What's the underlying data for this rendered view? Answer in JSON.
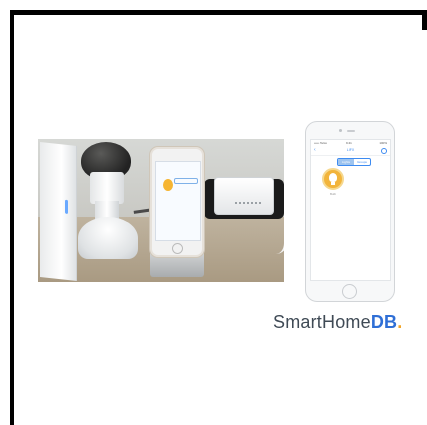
{
  "brand": {
    "prefix": "SmartHome",
    "suffix": "DB",
    "dot": "."
  },
  "phone_app": {
    "status": {
      "carrier": "••••• Telco",
      "time": "9:41",
      "battery": "100%"
    },
    "nav": {
      "back_icon": "chevron-left-icon",
      "title": "LIFX",
      "settings_icon": "gear-icon"
    },
    "segmented": [
      "Lights",
      "Groups"
    ],
    "selected_segment": 0,
    "device": {
      "icon": "lightbulb-icon",
      "label": "Bulb"
    }
  },
  "colors": {
    "accent": "#3d8bf1",
    "bulb": "#f2b43b",
    "brand_text": "#3f4a55",
    "brand_accent": "#2f6fd6",
    "brand_dot": "#f2a527"
  }
}
